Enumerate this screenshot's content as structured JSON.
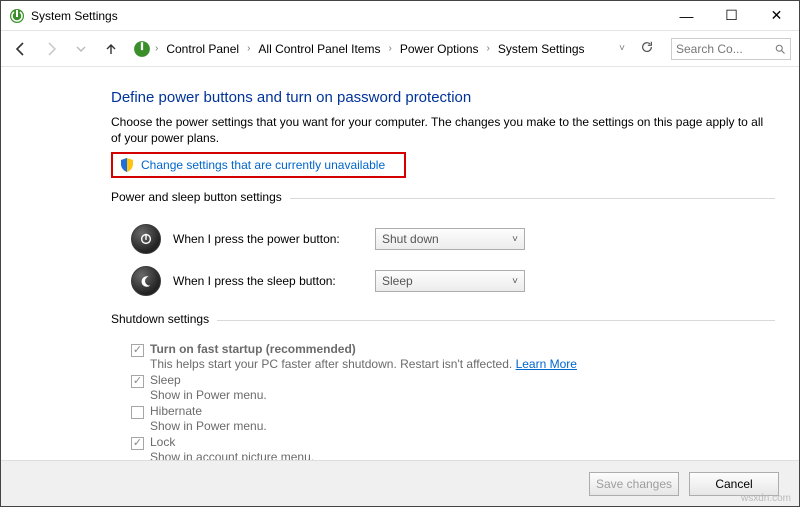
{
  "window": {
    "title": "System Settings",
    "minimize": "—",
    "maximize": "☐",
    "close": "✕"
  },
  "nav": {
    "crumbs": [
      "Control Panel",
      "All Control Panel Items",
      "Power Options",
      "System Settings"
    ],
    "search_placeholder": "Search Co..."
  },
  "page": {
    "title": "Define power buttons and turn on password protection",
    "intro": "Choose the power settings that you want for your computer. The changes you make to the settings on this page apply to all of your power plans.",
    "change_link": "Change settings that are currently unavailable"
  },
  "power_buttons": {
    "group_label": "Power and sleep button settings",
    "rows": [
      {
        "label": "When I press the power button:",
        "value": "Shut down"
      },
      {
        "label": "When I press the sleep button:",
        "value": "Sleep"
      }
    ]
  },
  "shutdown": {
    "group_label": "Shutdown settings",
    "items": [
      {
        "checked": true,
        "label": "Turn on fast startup (recommended)",
        "bold": true,
        "desc": "This helps start your PC faster after shutdown. Restart isn't affected. ",
        "learn": "Learn More"
      },
      {
        "checked": true,
        "label": "Sleep",
        "desc": "Show in Power menu."
      },
      {
        "checked": false,
        "label": "Hibernate",
        "desc": "Show in Power menu."
      },
      {
        "checked": true,
        "label": "Lock",
        "desc": "Show in account picture menu."
      }
    ]
  },
  "footer": {
    "save": "Save changes",
    "cancel": "Cancel"
  },
  "watermark": "wsxdn.com"
}
